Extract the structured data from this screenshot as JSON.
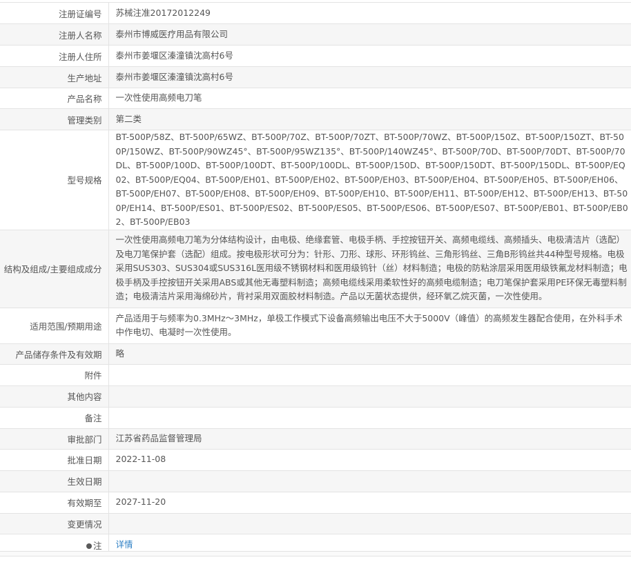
{
  "rows": [
    {
      "label": "注册证编号",
      "value": "苏械注准20172012249"
    },
    {
      "label": "注册人名称",
      "value": "泰州市博威医疗用品有限公司"
    },
    {
      "label": "注册人住所",
      "value": "泰州市姜堰区溱潼镇沈高村6号"
    },
    {
      "label": "生产地址",
      "value": "泰州市姜堰区溱潼镇沈高村6号"
    },
    {
      "label": "产品名称",
      "value": "一次性使用高频电刀笔"
    },
    {
      "label": "管理类别",
      "value": "第二类"
    },
    {
      "label": "型号规格",
      "value": "BT-500P/58Z、BT-500P/65WZ、BT-500P/70Z、BT-500P/70ZT、BT-500P/70WZ、BT-500P/150Z、BT-500P/150ZT、BT-500P/150WZ、BT-500P/90WZ45°、BT-500P/95WZ135°、BT-500P/140WZ45°、BT-500P/70D、BT-500P/70DT、BT-500P/70DL、BT-500P/100D、BT-500P/100DT、BT-500P/100DL、BT-500P/150D、BT-500P/150DT、BT-500P/150DL、BT-500P/EQ02、BT-500P/EQ04、BT-500P/EH01、BT-500P/EH02、BT-500P/EH03、BT-500P/EH04、BT-500P/EH05、BT-500P/EH06、BT-500P/EH07、BT-500P/EH08、BT-500P/EH09、BT-500P/EH10、BT-500P/EH11、BT-500P/EH12、BT-500P/EH13、BT-500P/EH14、BT-500P/ES01、BT-500P/ES02、BT-500P/ES05、BT-500P/ES06、BT-500P/ES07、BT-500P/EB01、BT-500P/EB02、BT-500P/EB03"
    },
    {
      "label": "结构及组成/主要组成成分",
      "value": "一次性使用高频电刀笔为分体结构设计，由电极、绝缘套管、电极手柄、手控按钮开关、高频电缆线、高频插头、电极清洁片（选配）及电刀笔保护套（选配）组成。按电极形状可分为：针形、刀形、球形、环形钨丝、三角形钨丝、三角B形钨丝共44种型号规格。电极采用SUS303、SUS304或SUS316L医用级不锈钢材料和医用级钨针（丝）材料制造；电极的防粘涂层采用医用级铁氟龙材料制造；电极手柄及手控按钮开关采用ABS或其他无毒塑料制造；高频电缆线采用柔软性好的高频电缆制造；电刀笔保护套采用PE环保无毒塑料制造；电极清洁片采用海绵砂片，背衬采用双面胶材料制造。产品以无菌状态提供，经环氧乙烷灭菌，一次性使用。"
    },
    {
      "label": "适用范围/预期用途",
      "value": "产品适用于与频率为0.3MHz～3MHz，单极工作模式下设备高频输出电压不大于5000V（峰值）的高频发生器配合使用，在外科手术中作电切、电凝时一次性使用。"
    },
    {
      "label": "产品储存条件及有效期",
      "value": "略"
    },
    {
      "label": "附件",
      "value": ""
    },
    {
      "label": "其他内容",
      "value": ""
    },
    {
      "label": "备注",
      "value": ""
    },
    {
      "label": "审批部门",
      "value": "江苏省药品监督管理局"
    },
    {
      "label": "批准日期",
      "value": "2022-11-08"
    },
    {
      "label": "生效日期",
      "value": ""
    },
    {
      "label": "有效期至",
      "value": "2027-11-20"
    },
    {
      "label": "变更情况",
      "value": ""
    }
  ],
  "note_row": {
    "label": "注",
    "icon": "bulb-icon",
    "link_text": "详情"
  },
  "colors": {
    "link": "#2d7fc4",
    "border": "#e3e3e3",
    "stripe": "#f6f6f6",
    "text": "#555555"
  }
}
